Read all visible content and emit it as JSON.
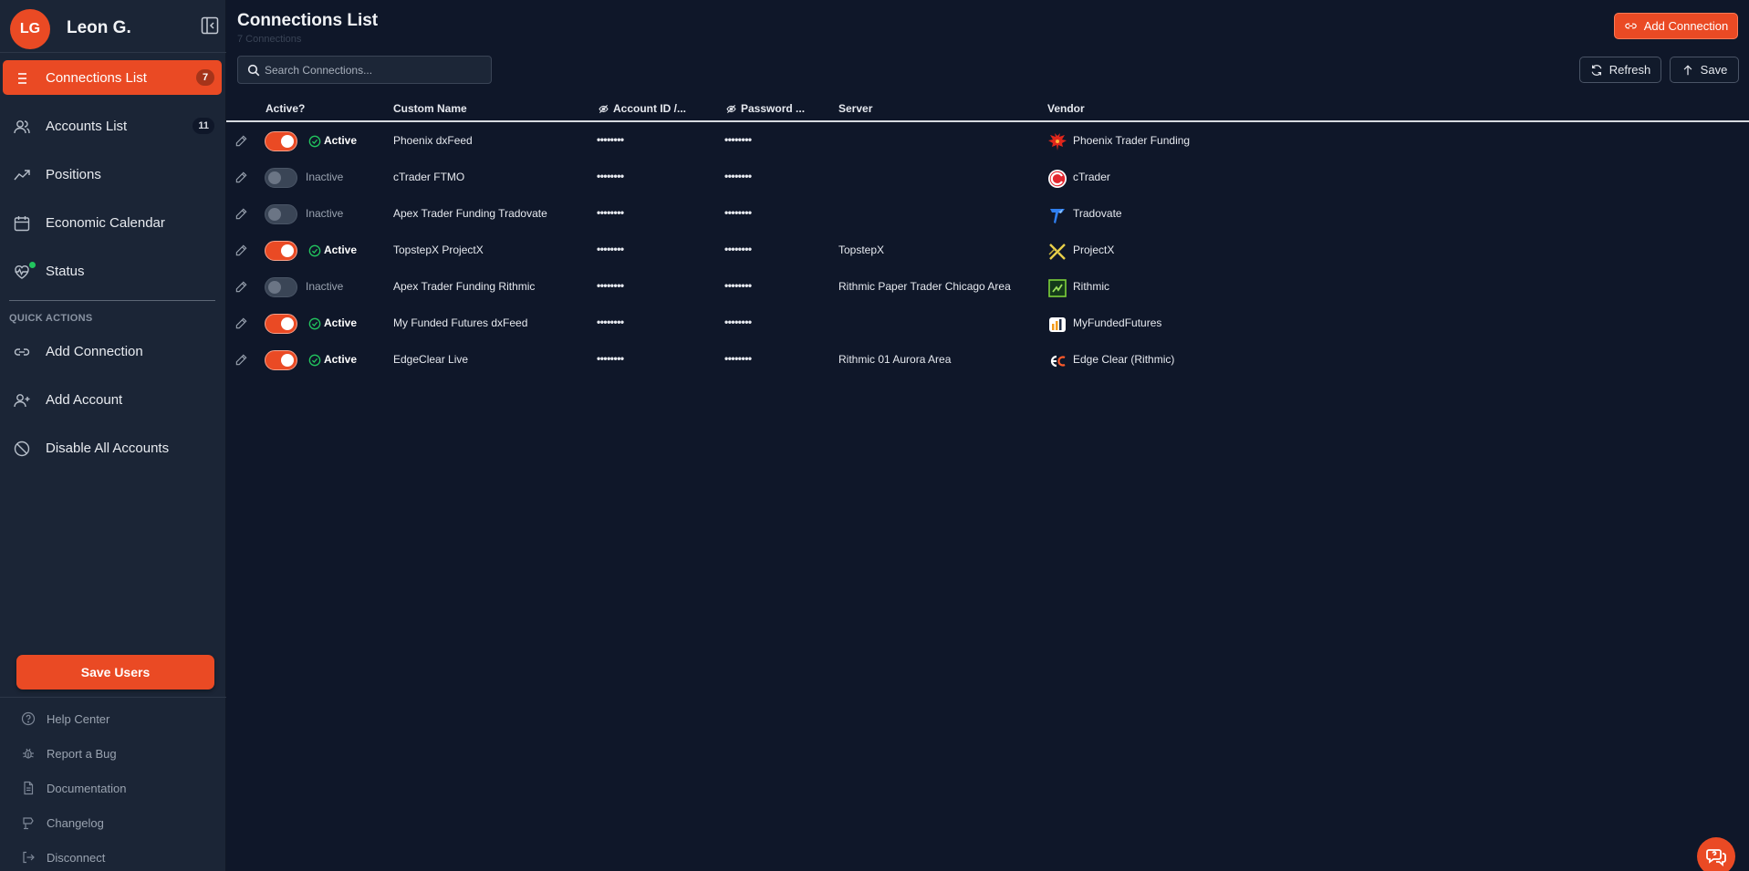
{
  "user": {
    "initials": "LG",
    "name": "Leon G."
  },
  "nav": [
    {
      "label": "Connections List",
      "badge": "7",
      "icon": "list-icon",
      "active": true
    },
    {
      "label": "Accounts List",
      "badge": "11",
      "icon": "users-icon",
      "active": false
    },
    {
      "label": "Positions",
      "badge": "",
      "icon": "trending-up-icon",
      "active": false
    },
    {
      "label": "Economic Calendar",
      "badge": "",
      "icon": "calendar-icon",
      "active": false
    },
    {
      "label": "Status",
      "badge": "",
      "icon": "heart-pulse-icon",
      "active": false
    }
  ],
  "quick_actions": {
    "heading": "QUICK ACTIONS",
    "items": [
      {
        "label": "Add Connection",
        "icon": "link-icon"
      },
      {
        "label": "Add Account",
        "icon": "user-plus-icon"
      },
      {
        "label": "Disable All Accounts",
        "icon": "ban-icon"
      }
    ]
  },
  "save_users_label": "Save Users",
  "footer": [
    {
      "label": "Help Center",
      "icon": "help-circle-icon"
    },
    {
      "label": "Report a Bug",
      "icon": "bug-icon"
    },
    {
      "label": "Documentation",
      "icon": "document-icon"
    },
    {
      "label": "Changelog",
      "icon": "changelog-icon"
    },
    {
      "label": "Disconnect",
      "icon": "logout-icon"
    }
  ],
  "main": {
    "title": "Connections List",
    "subtitle": "7 Connections",
    "add_connection_label": "Add Connection",
    "refresh_label": "Refresh",
    "save_label": "Save",
    "search": {
      "placeholder": "Search Connections...",
      "value": ""
    }
  },
  "table": {
    "columns": {
      "active": "Active?",
      "name": "Custom Name",
      "account": "Account ID /...",
      "password": "Password ...",
      "server": "Server",
      "vendor": "Vendor"
    },
    "rows": [
      {
        "active": true,
        "status": "Active",
        "name": "Phoenix dxFeed",
        "account": "••••••••",
        "password": "••••••••",
        "server": "",
        "vendor": "Phoenix Trader Funding",
        "vendor_icon": "phoenix-logo-icon"
      },
      {
        "active": false,
        "status": "Inactive",
        "name": "cTrader FTMO",
        "account": "••••••••",
        "password": "••••••••",
        "server": "",
        "vendor": "cTrader",
        "vendor_icon": "ctrader-logo-icon"
      },
      {
        "active": false,
        "status": "Inactive",
        "name": "Apex Trader Funding Tradovate",
        "account": "••••••••",
        "password": "••••••••",
        "server": "",
        "vendor": "Tradovate",
        "vendor_icon": "tradovate-logo-icon"
      },
      {
        "active": true,
        "status": "Active",
        "name": "TopstepX ProjectX",
        "account": "••••••••",
        "password": "••••••••",
        "server": "TopstepX",
        "vendor": "ProjectX",
        "vendor_icon": "projectx-logo-icon"
      },
      {
        "active": false,
        "status": "Inactive",
        "name": "Apex Trader Funding Rithmic",
        "account": "••••••••",
        "password": "••••••••",
        "server": "Rithmic Paper Trader Chicago Area",
        "vendor": "Rithmic",
        "vendor_icon": "rithmic-logo-icon"
      },
      {
        "active": true,
        "status": "Active",
        "name": "My Funded Futures dxFeed",
        "account": "••••••••",
        "password": "••••••••",
        "server": "",
        "vendor": "MyFundedFutures",
        "vendor_icon": "myfundedfutures-logo-icon"
      },
      {
        "active": true,
        "status": "Active",
        "name": "EdgeClear Live",
        "account": "••••••••",
        "password": "••••••••",
        "server": "Rithmic 01 Aurora Area",
        "vendor": "Edge Clear (Rithmic)",
        "vendor_icon": "edgeclear-logo-icon"
      }
    ]
  },
  "colors": {
    "accent": "#ea4a24",
    "background": "#0f1729",
    "sidebar": "#1b2536",
    "success": "#22c55e"
  }
}
